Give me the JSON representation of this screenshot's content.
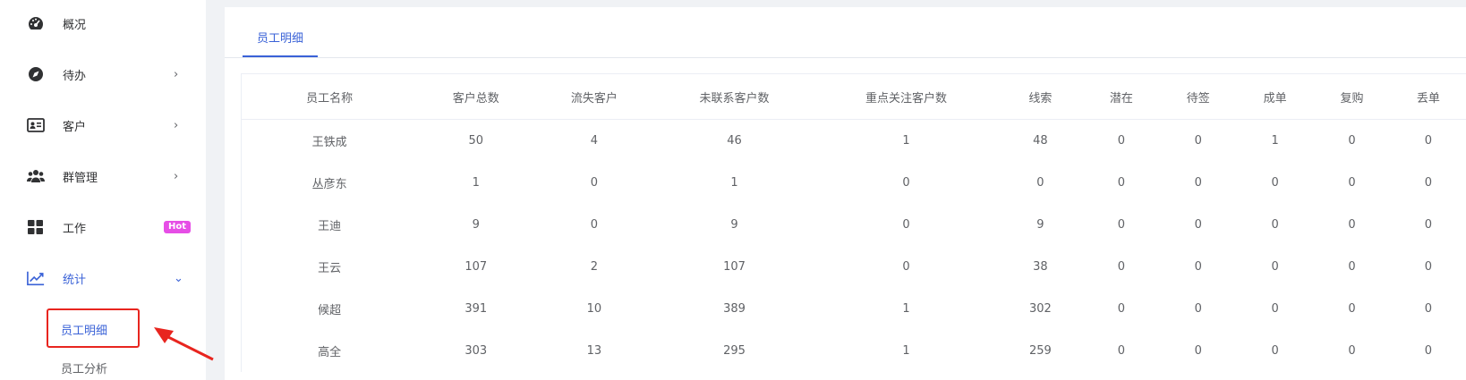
{
  "sidebar": {
    "items": [
      {
        "label": "概况",
        "icon": "dashboard-icon",
        "chevron": ""
      },
      {
        "label": "待办",
        "icon": "compass-icon",
        "chevron": "›"
      },
      {
        "label": "客户",
        "icon": "contact-card-icon",
        "chevron": "›"
      },
      {
        "label": "群管理",
        "icon": "group-icon",
        "chevron": "›"
      },
      {
        "label": "工作",
        "icon": "grid-icon",
        "badge": "Hot"
      },
      {
        "label": "统计",
        "icon": "trend-chart-icon",
        "chevron": "⌄"
      }
    ],
    "sub_items": [
      {
        "label": "员工明细"
      },
      {
        "label": "员工分析"
      }
    ]
  },
  "main": {
    "tab_label": "员工明细",
    "columns": [
      "员工名称",
      "客户总数",
      "流失客户",
      "未联系客户数",
      "重点关注客户数",
      "线索",
      "潜在",
      "待签",
      "成单",
      "复购",
      "丢单"
    ],
    "rows": [
      [
        "王铁成",
        "50",
        "4",
        "46",
        "1",
        "48",
        "0",
        "0",
        "1",
        "0",
        "0"
      ],
      [
        "丛彦东",
        "1",
        "0",
        "1",
        "0",
        "0",
        "0",
        "0",
        "0",
        "0",
        "0"
      ],
      [
        "王迪",
        "9",
        "0",
        "9",
        "0",
        "9",
        "0",
        "0",
        "0",
        "0",
        "0"
      ],
      [
        "王云",
        "107",
        "2",
        "107",
        "0",
        "38",
        "0",
        "0",
        "0",
        "0",
        "0"
      ],
      [
        "候超",
        "391",
        "10",
        "389",
        "1",
        "302",
        "0",
        "0",
        "0",
        "0",
        "0"
      ],
      [
        "高全",
        "303",
        "13",
        "295",
        "1",
        "259",
        "0",
        "0",
        "0",
        "0",
        "0"
      ]
    ]
  },
  "colors": {
    "accent": "#3a62d7",
    "highlight": "#e8251f",
    "hot_badge": "#e64ee6"
  }
}
